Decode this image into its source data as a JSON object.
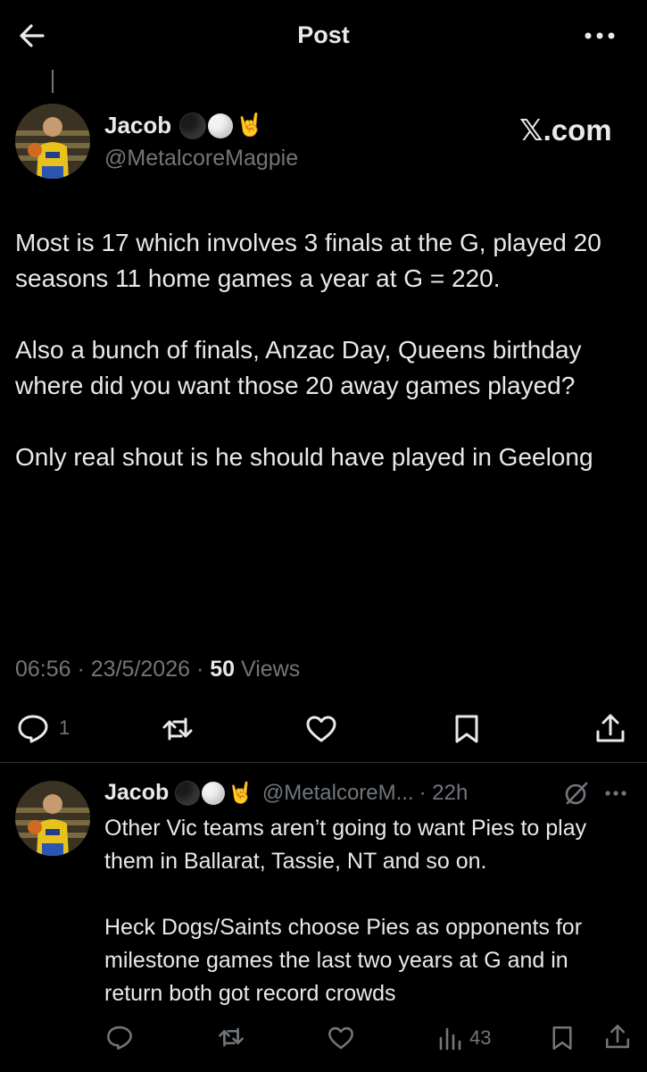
{
  "header": {
    "title": "Post"
  },
  "post": {
    "author_name": "Jacob",
    "handle": "@MetalcoreMagpie",
    "source_badge": "𝕏.com",
    "paragraphs": [
      "Most is 17 which involves 3 finals at the G, played 20 seasons 11 home games a year at G = 220.",
      "Also a bunch of finals, Anzac Day, Queens birthday where did you want those 20 away games played?",
      "Only real shout is he should have played in Geelong"
    ],
    "time": "06:56",
    "sep1": " · ",
    "date": "23/5/2026",
    "sep2": " · ",
    "views_count": "50",
    "views_label": " Views",
    "reply_count": "1"
  },
  "reply": {
    "author_name": "Jacob",
    "handle": "@MetalcoreM...",
    "age": "· 22h",
    "paragraphs": [
      "Other Vic teams aren’t going to want Pies to play them in Ballarat, Tassie, NT and so on.",
      "Heck Dogs/Saints choose Pies as opponents for milestone games the last two years at G and in return both got record crowds"
    ],
    "views_count": "43"
  },
  "emoji": {
    "hand": "🤘"
  }
}
